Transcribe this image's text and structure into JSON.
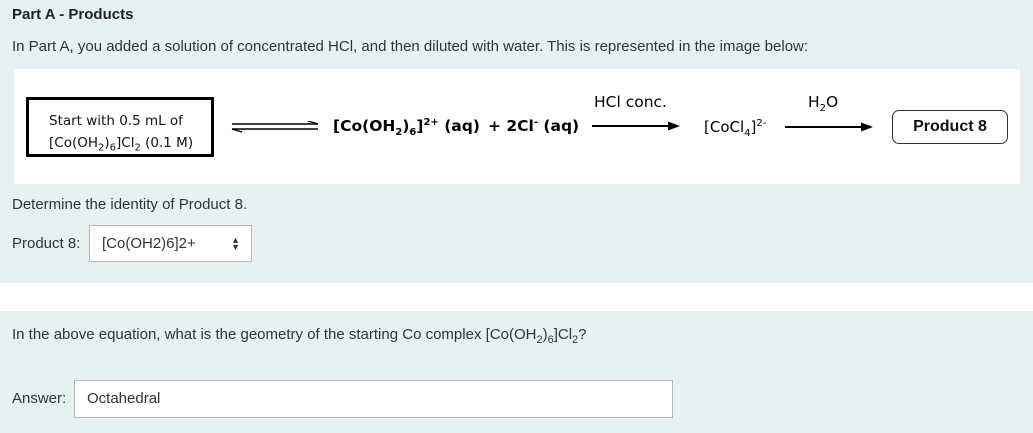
{
  "part_a": {
    "title": "Part A - Products",
    "intro": "In Part A, you added a solution of concentrated HCl, and then diluted with water. This is represented in the image below:"
  },
  "scheme": {
    "start_line1": "Start with 0.5 mL of",
    "start_formula_parts": [
      "[Co(OH",
      "2",
      ")",
      "6",
      "]Cl",
      "2",
      " (0.1 M)"
    ],
    "reactant_parts": [
      "[Co(OH",
      "2",
      ")",
      "6",
      "]",
      "2+",
      " (aq)"
    ],
    "chloride_parts": [
      "+ 2Cl",
      "-",
      " (aq)"
    ],
    "reagent_1": "HCl conc.",
    "intermediate_parts": [
      "[CoCl",
      "4",
      "]",
      "2-"
    ],
    "reagent_2_parts": [
      "H",
      "2",
      "O"
    ],
    "product_label": "Product 8"
  },
  "question_1": {
    "prompt": "Determine the identity of Product 8.",
    "field_label": "Product 8:",
    "selected_value": "[Co(OH2)6]2+"
  },
  "question_2": {
    "prompt_parts": [
      "In the above equation, what is the geometry of the starting Co complex [Co(OH",
      "2",
      ")",
      "6",
      "]Cl",
      "2",
      "?"
    ],
    "field_label": "Answer:",
    "value": "Octahedral"
  }
}
